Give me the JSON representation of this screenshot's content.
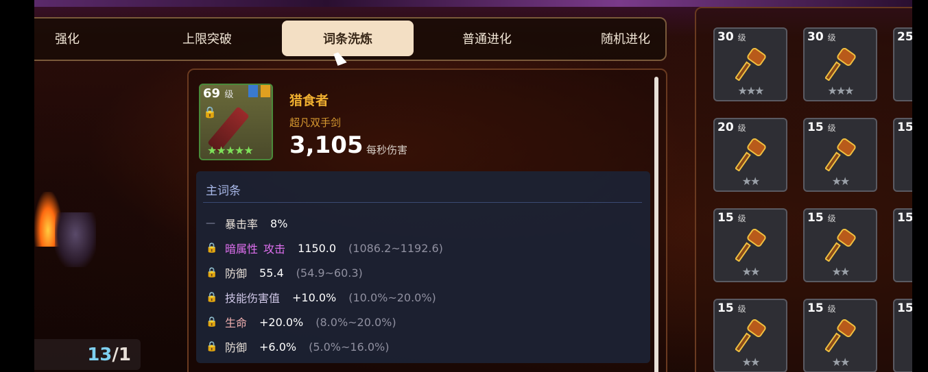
{
  "tabs": [
    {
      "label": "强化",
      "active": false
    },
    {
      "label": "上限突破",
      "active": false
    },
    {
      "label": "词条洗炼",
      "active": true
    },
    {
      "label": "普通进化",
      "active": false
    },
    {
      "label": "随机进化",
      "active": false
    }
  ],
  "counter": {
    "value": "13",
    "total": "/1"
  },
  "item": {
    "level": "69",
    "level_unit": "级",
    "name": "猎食者",
    "type": "超凡双手剑",
    "dps": "3,105",
    "dps_label": "每秒伤害",
    "stars": "★★★★★"
  },
  "affix": {
    "heading": "主词条",
    "rows": [
      {
        "name": "暴击率",
        "value": "8%",
        "range": ""
      },
      {
        "name": "暗属性",
        "name2": "攻击",
        "value": "1150.0",
        "range": "(1086.2~1192.6)"
      },
      {
        "name": "防御",
        "value": "55.4",
        "range": "(54.9~60.3)"
      },
      {
        "name": "技能伤害值",
        "value": "+10.0%",
        "range": "(10.0%~20.0%)"
      },
      {
        "name": "生命",
        "value": "+20.0%",
        "range": "(8.0%~20.0%)"
      },
      {
        "name": "防御",
        "value": "+6.0%",
        "range": "(5.0%~16.0%)"
      }
    ]
  },
  "materials": [
    {
      "level": "30",
      "unit": "级",
      "stars": "★★★"
    },
    {
      "level": "30",
      "unit": "级",
      "stars": "★★★"
    },
    {
      "level": "25",
      "unit": "",
      "stars": ""
    },
    {
      "level": "20",
      "unit": "级",
      "stars": "★★"
    },
    {
      "level": "15",
      "unit": "级",
      "stars": "★★"
    },
    {
      "level": "15",
      "unit": "",
      "stars": ""
    },
    {
      "level": "15",
      "unit": "级",
      "stars": "★★"
    },
    {
      "level": "15",
      "unit": "级",
      "stars": "★★"
    },
    {
      "level": "15",
      "unit": "",
      "stars": ""
    },
    {
      "level": "15",
      "unit": "级",
      "stars": "★★"
    },
    {
      "level": "15",
      "unit": "级",
      "stars": "★★"
    },
    {
      "level": "15",
      "unit": "",
      "stars": ""
    }
  ],
  "colors": {
    "accent": "#f3dfc4",
    "item_name": "#f0b030",
    "dark_attr": "#e070f0"
  }
}
